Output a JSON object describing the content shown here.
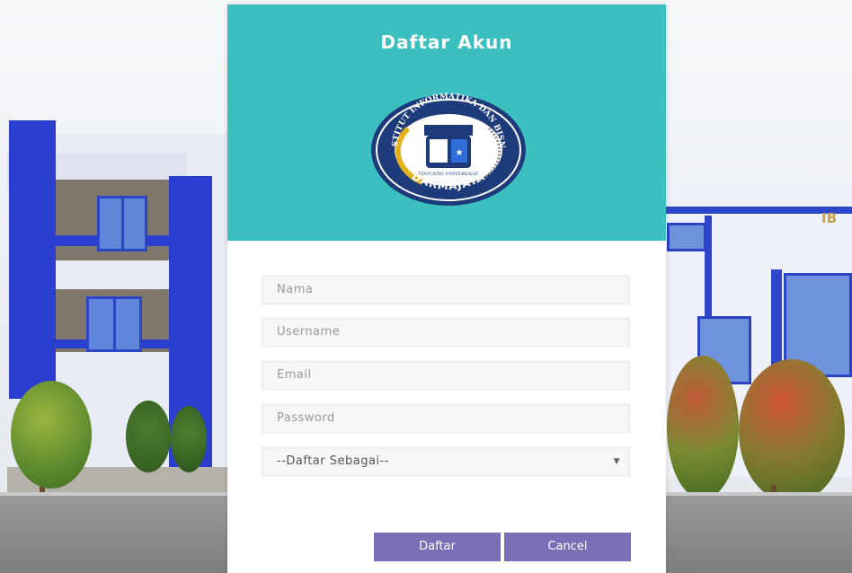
{
  "form": {
    "title": "Daftar Akun",
    "logo_alt": "Institut Informatika dan Bisnis Darmajaya logo",
    "logo_text_top": "INSTITUT INFORMATIKA DAN BISNIS",
    "logo_text_bottom": "DARMAJAYA",
    "logo_motto": "EDUCATIO UNIVERSALIS",
    "fields": {
      "nama_placeholder": "Nama",
      "username_placeholder": "Username",
      "email_placeholder": "Email",
      "password_placeholder": "Password"
    },
    "role_select": {
      "selected": "--Daftar Sebagai--"
    },
    "buttons": {
      "submit_label": "Daftar",
      "cancel_label": "Cancel"
    }
  },
  "background": {
    "building_sign": "IB"
  },
  "colors": {
    "header": "#3bbfbf",
    "button": "#7a6fb6",
    "building_blue": "#2a3fd0"
  }
}
